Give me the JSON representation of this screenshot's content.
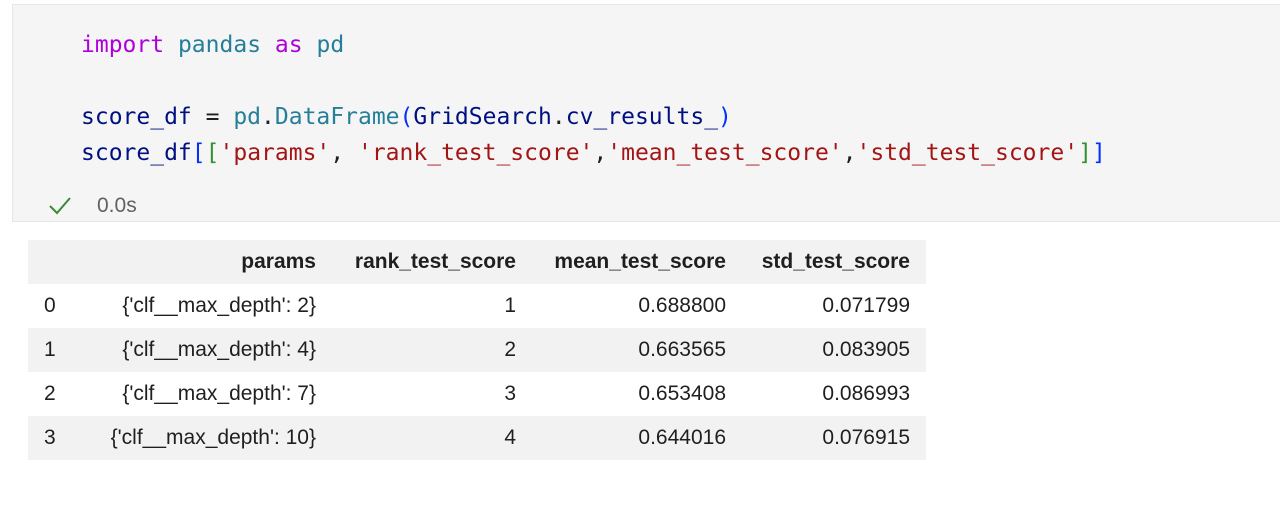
{
  "code_cell": {
    "lines": [
      [
        {
          "t": "import",
          "c": "kw"
        },
        {
          "t": " ",
          "c": "plain"
        },
        {
          "t": "pandas",
          "c": "mod"
        },
        {
          "t": " ",
          "c": "plain"
        },
        {
          "t": "as",
          "c": "kw"
        },
        {
          "t": " ",
          "c": "plain"
        },
        {
          "t": "pd",
          "c": "mod"
        }
      ],
      [],
      [
        {
          "t": "score_df",
          "c": "var"
        },
        {
          "t": " = ",
          "c": "plain"
        },
        {
          "t": "pd",
          "c": "mod"
        },
        {
          "t": ".",
          "c": "plain"
        },
        {
          "t": "DataFrame",
          "c": "fn"
        },
        {
          "t": "(",
          "c": "br1"
        },
        {
          "t": "GridSearch",
          "c": "var"
        },
        {
          "t": ".",
          "c": "plain"
        },
        {
          "t": "cv_results_",
          "c": "var"
        },
        {
          "t": ")",
          "c": "br1"
        }
      ],
      [
        {
          "t": "score_df",
          "c": "var"
        },
        {
          "t": "[",
          "c": "br1"
        },
        {
          "t": "[",
          "c": "br2"
        },
        {
          "t": "'params'",
          "c": "str"
        },
        {
          "t": ", ",
          "c": "plain"
        },
        {
          "t": "'rank_test_score'",
          "c": "str"
        },
        {
          "t": ",",
          "c": "plain"
        },
        {
          "t": "'mean_test_score'",
          "c": "str"
        },
        {
          "t": ",",
          "c": "plain"
        },
        {
          "t": "'std_test_score'",
          "c": "str"
        },
        {
          "t": "]",
          "c": "br2"
        },
        {
          "t": "]",
          "c": "br1"
        }
      ]
    ],
    "status": {
      "icon": "check-icon",
      "icon_color": "#388a34",
      "duration": "0.0s"
    }
  },
  "output_table": {
    "columns": [
      "",
      "params",
      "rank_test_score",
      "mean_test_score",
      "std_test_score"
    ],
    "rows": [
      {
        "index": "0",
        "params": "{'clf__max_depth': 2}",
        "rank_test_score": "1",
        "mean_test_score": "0.688800",
        "std_test_score": "0.071799"
      },
      {
        "index": "1",
        "params": "{'clf__max_depth': 4}",
        "rank_test_score": "2",
        "mean_test_score": "0.663565",
        "std_test_score": "0.083905"
      },
      {
        "index": "2",
        "params": "{'clf__max_depth': 7}",
        "rank_test_score": "3",
        "mean_test_score": "0.653408",
        "std_test_score": "0.086993"
      },
      {
        "index": "3",
        "params": "{'clf__max_depth': 10}",
        "rank_test_score": "4",
        "mean_test_score": "0.644016",
        "std_test_score": "0.076915"
      }
    ]
  }
}
